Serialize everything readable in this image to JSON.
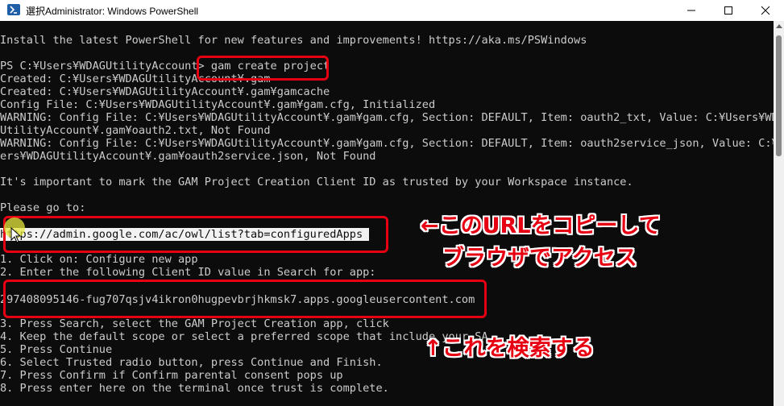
{
  "window": {
    "title": "選択Administrator: Windows PowerShell"
  },
  "console": {
    "lines": [
      "Install the latest PowerShell for new features and improvements! https://aka.ms/PSWindows",
      "",
      "PS C:¥Users¥WDAGUtilityAccount> gam create project",
      "Created: C:¥Users¥WDAGUtilityAccount¥.gam",
      "Created: C:¥Users¥WDAGUtilityAccount¥.gam¥gamcache",
      "Config File: C:¥Users¥WDAGUtilityAccount¥.gam¥gam.cfg, Initialized",
      "WARNING: Config File: C:¥Users¥WDAGUtilityAccount¥.gam¥gam.cfg, Section: DEFAULT, Item: oauth2_txt, Value: C:¥Users¥WDAG",
      "UtilityAccount¥.gam¥oauth2.txt, Not Found",
      "WARNING: Config File: C:¥Users¥WDAGUtilityAccount¥.gam¥gam.cfg, Section: DEFAULT, Item: oauth2service_json, Value: C:¥Us",
      "ers¥WDAGUtilityAccount¥.gam¥oauth2service.json, Not Found",
      "",
      "It's important to mark the GAM Project Creation Client ID as trusted by your Workspace instance.",
      "",
      "Please go to:",
      "",
      "https://admin.google.com/ac/owl/list?tab=configuredApps ",
      "",
      "1. Click on: Configure new app",
      "2. Enter the following Client ID value in Search for app:",
      "",
      "297408095146-fug707qsjv4ikron0hugpevbrjhkmsk7.apps.googleusercontent.com",
      "",
      "3. Press Search, select the GAM Project Creation app, click",
      "4. Keep the default scope or select a preferred scope that include your SA",
      "5. Press Continue",
      "6. Select Trusted radio button, press Continue and Finish.",
      "7. Press Confirm if Confirm parental consent pops up",
      "8. Press enter here on the terminal once trust is complete."
    ]
  },
  "annotations": {
    "copy_url_line1": "←このURLをコピーして",
    "copy_url_line2": "ブラウザでアクセス",
    "search_this": "↑これを検索する"
  },
  "colors": {
    "console_bg": "#0c0c0c",
    "console_text": "#cccccc",
    "annotation_red": "#e60012",
    "selection_bg": "#f2f2f2"
  },
  "icons": [
    "powershell-icon",
    "minimize-icon",
    "maximize-icon",
    "close-icon",
    "mouse-cursor-icon"
  ]
}
